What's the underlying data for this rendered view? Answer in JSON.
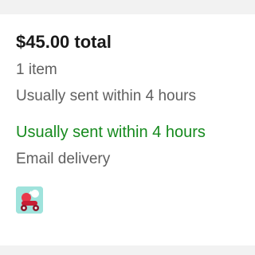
{
  "order_summary": {
    "total_label": "$45.00 total",
    "item_count": "1 item",
    "shipping_note": "Usually sent within 4 hours"
  },
  "delivery": {
    "status": "Usually sent within 4 hours",
    "status_color": "#168a1e",
    "method": "Email delivery"
  },
  "gift_card_thumbnail": {
    "icon": "gift-card-thumbnail-icon"
  }
}
